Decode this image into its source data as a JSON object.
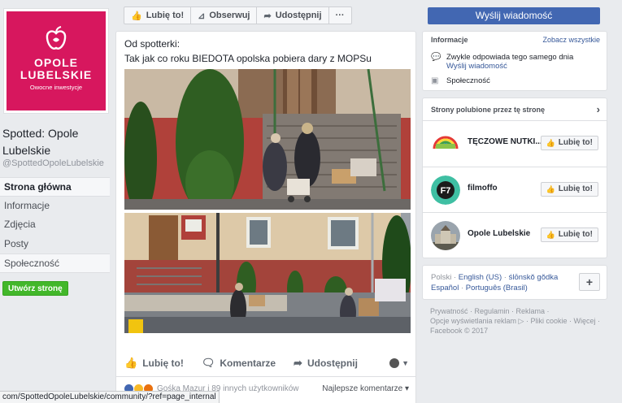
{
  "page": {
    "logo": {
      "line1": "OPOLE",
      "line2": "LUBELSKIE",
      "tagline": "Owocne inwestycje",
      "bg": "#d7175e"
    },
    "name": "Spotted: Opole Lubelskie",
    "handle": "@SpottedOpoleLubelskie",
    "nav": [
      "Strona główna",
      "Informacje",
      "Zdjęcia",
      "Posty",
      "Społeczność"
    ],
    "create_page_label": "Utwórz stronę"
  },
  "actionbar": {
    "like": "Lubię to!",
    "follow": "Obserwuj",
    "share": "Udostępnij",
    "more": "···",
    "send_message": "Wyślij wiadomość"
  },
  "post": {
    "line1": "Od spotterki:",
    "line2": "Tak jak co roku BIEDOTA opolska pobiera dary z MOPSu",
    "actions": {
      "like": "Lubię to!",
      "comment": "Komentarze",
      "share": "Udostępnij"
    },
    "reactions_text": "Gośka Mazur i 89 innych użytkowników",
    "sort_label": "Najlepsze komentarze ▾"
  },
  "info": {
    "title": "Informacje",
    "see_all": "Zobacz wszystkie",
    "response_text": "Zwykle odpowiada tego samego dnia",
    "send_message_link": "Wyślij wiadomość",
    "community": "Społeczność"
  },
  "liked_pages": {
    "title": "Strony polubione przez tę stronę",
    "items": [
      {
        "name": "TĘCZOWE NUTKI...",
        "button": "Lubię to!"
      },
      {
        "name": "filmoffo",
        "button": "Lubię to!"
      },
      {
        "name": "Opole Lubelskie",
        "button": "Lubię to!"
      }
    ]
  },
  "languages": {
    "current": "Polski",
    "others_line1": [
      "English (US)",
      "ślōnskŏ gŏdka"
    ],
    "others_line2": [
      "Español",
      "Português (Brasil)"
    ],
    "plus": "+"
  },
  "footer": {
    "line1": "Prywatność · Regulamin · Reklama ·",
    "line2": "Opcje wyświetlania reklam ▷ · Pliki cookie · Więcej ·",
    "line3": "Facebook © 2017"
  },
  "status_url": "com/SpottedOpoleLubelskie/community/?ref=page_internal",
  "colors": {
    "facebook_blue": "#4267b2",
    "link": "#365899",
    "green": "#42b72a"
  }
}
